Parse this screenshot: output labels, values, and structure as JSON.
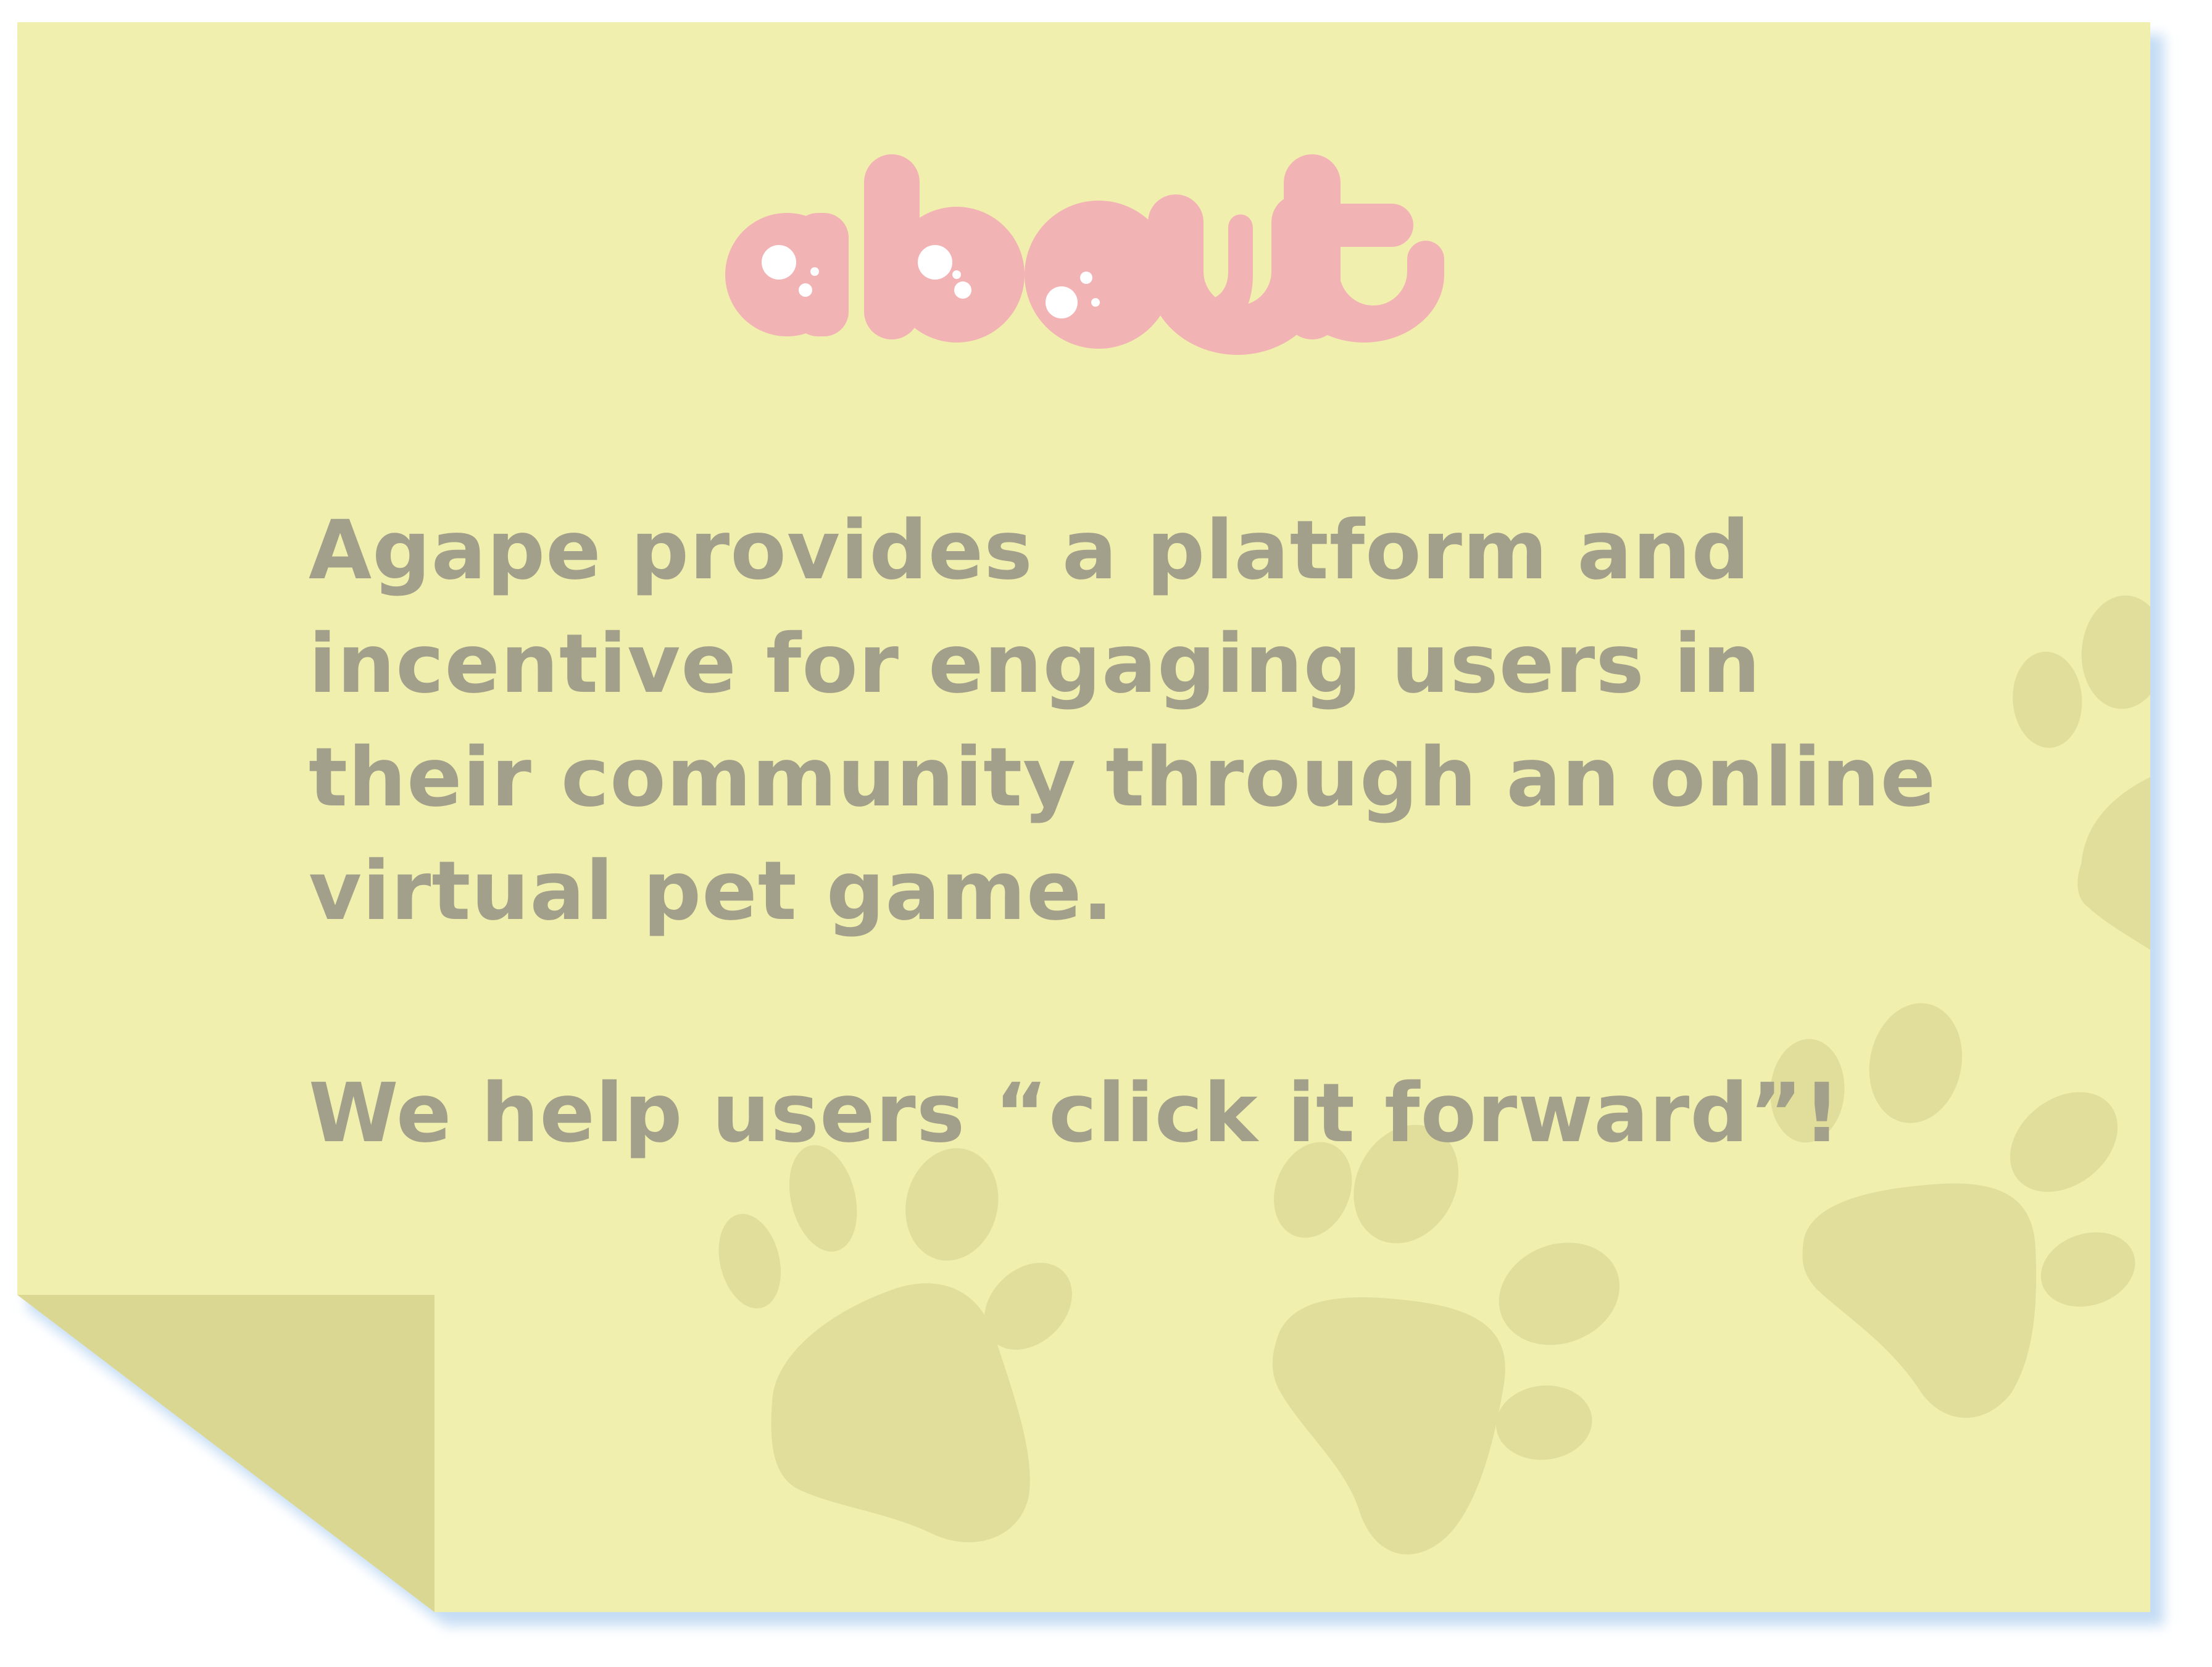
{
  "note": {
    "title": "about",
    "paragraph": "Agape provides a platform and incentive for engaging users in their community through an online virtual pet game.",
    "tagline": "We help users “click it forward”!"
  },
  "decorations": {
    "paw_print_icons": [
      "paw-print-icon",
      "paw-print-icon",
      "paw-print-icon",
      "paw-print-icon"
    ],
    "corner": "folded-corner"
  },
  "colors": {
    "note_fill": "#f0efae",
    "fold_fill": "#dad793",
    "shadow": "#c4dcf4",
    "title_pink": "#f2b3b5",
    "body_text": "#a2a08a",
    "paw_fill": "#e0de9a"
  }
}
